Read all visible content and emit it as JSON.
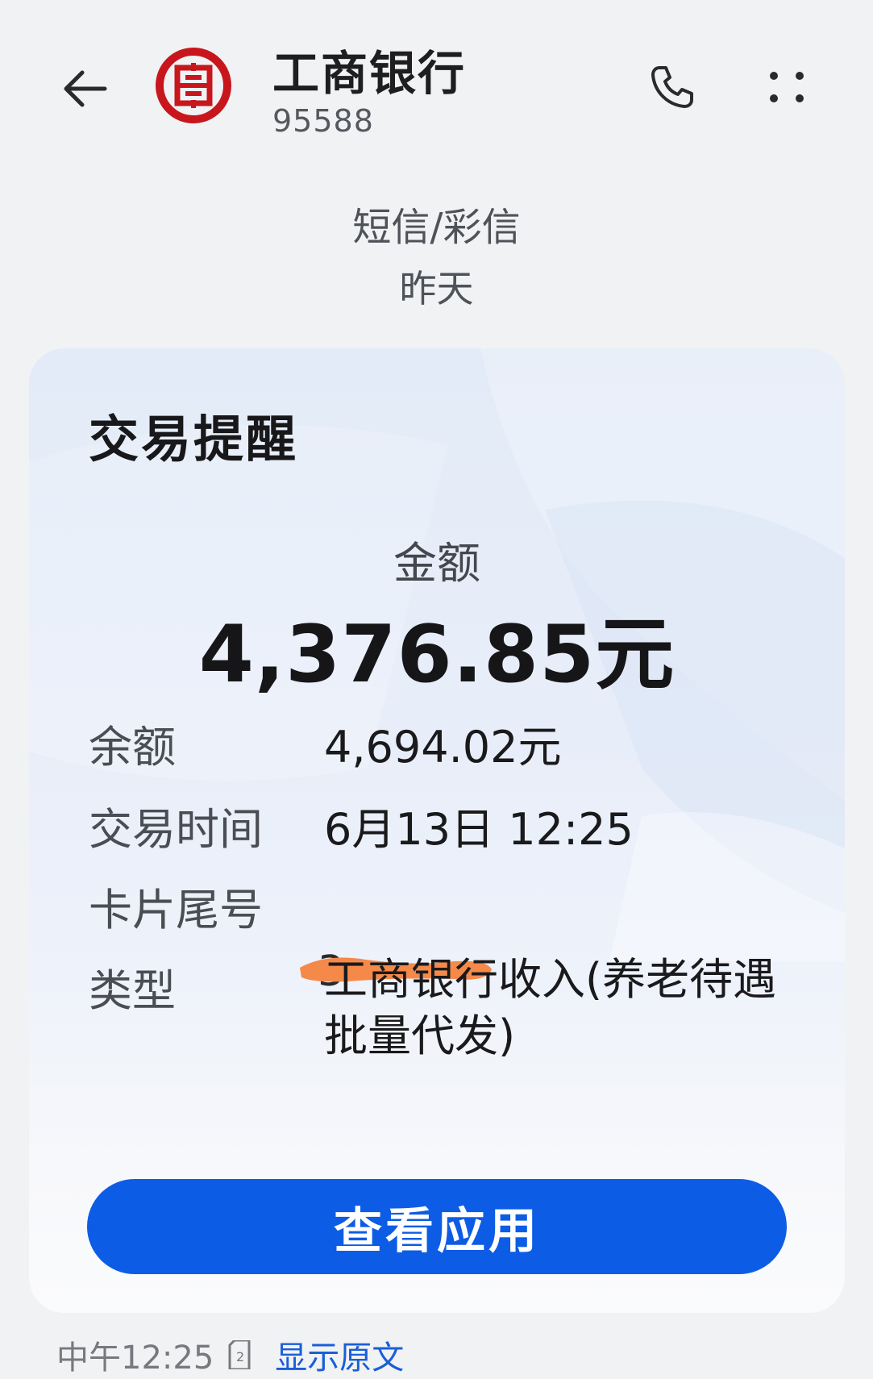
{
  "header": {
    "contact_name": "工商银行",
    "contact_number": "95588",
    "icons": {
      "back": "back-arrow-icon",
      "logo": "icbc-logo-icon",
      "call": "phone-icon",
      "more": "more-dots-icon"
    },
    "brand_color": "#c8161d"
  },
  "message_meta": {
    "type": "短信/彩信",
    "day": "昨天"
  },
  "card": {
    "title": "交易提醒",
    "amount_label": "金额",
    "amount_value": "4,376.85元",
    "rows": [
      {
        "label": "余额",
        "value": "4,694.02元"
      },
      {
        "label": "交易时间",
        "value": "6月13日 12:25"
      },
      {
        "label": "卡片尾号",
        "value": ""
      },
      {
        "label": "类型",
        "value": "工商银行收入(养老待遇批量代发)"
      }
    ],
    "redaction_color": "#f4894a",
    "button_label": "查看应用",
    "button_color": "#0d5ce6"
  },
  "footer": {
    "time": "中午12:25",
    "sim_icon": "sim-card-icon",
    "link_label": "显示原文",
    "link_color": "#1a5fd6"
  }
}
